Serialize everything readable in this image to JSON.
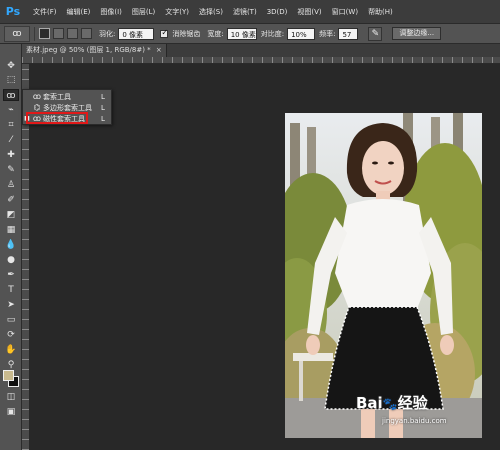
{
  "app": {
    "logo": "Ps"
  },
  "menu": [
    "文件(F)",
    "编辑(E)",
    "图像(I)",
    "图层(L)",
    "文字(Y)",
    "选择(S)",
    "滤镜(T)",
    "3D(D)",
    "视图(V)",
    "窗口(W)",
    "帮助(H)"
  ],
  "options": {
    "feather_label": "羽化:",
    "feather_value": "0 像素",
    "antialias_label": "消除锯齿",
    "width_label": "宽度:",
    "width_value": "10 像素",
    "contrast_label": "对比度:",
    "contrast_value": "10%",
    "frequency_label": "频率:",
    "frequency_value": "57",
    "refine_edge_label": "调整边缘..."
  },
  "document": {
    "tab_title": "素材.jpeg @ 50% (图层 1, RGB/8#) *",
    "close_glyph": "×"
  },
  "lasso_menu": {
    "items": [
      {
        "label": "套索工具",
        "shortcut": "L",
        "selected": false
      },
      {
        "label": "多边形套索工具",
        "shortcut": "L",
        "selected": false
      },
      {
        "label": "磁性套索工具",
        "shortcut": "L",
        "selected": true
      }
    ],
    "highlight_color": "#e01919"
  },
  "watermark": {
    "logo_text": "Bai",
    "logo_suffix": "经验",
    "url": "jingyan.baidu.com"
  },
  "colors": {
    "foreground": "#c8b98e",
    "background": "#101010",
    "accent": "#31a8ff"
  }
}
